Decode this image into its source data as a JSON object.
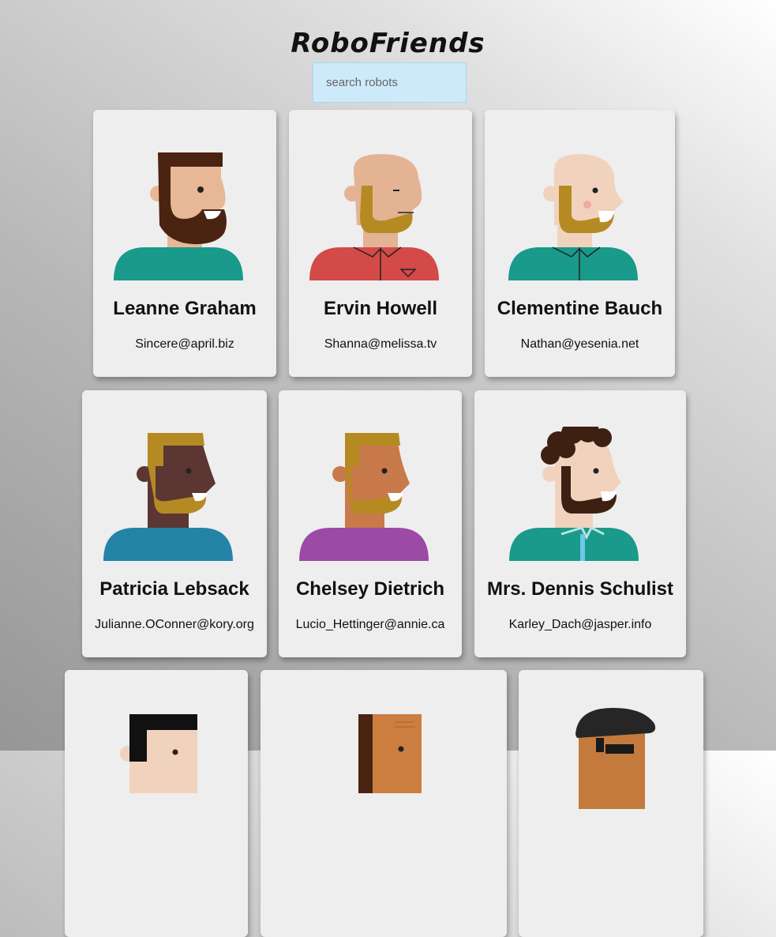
{
  "app": {
    "title": "RoboFriends"
  },
  "search": {
    "placeholder": "search robots",
    "value": ""
  },
  "robots": [
    {
      "name": "Leanne Graham",
      "email": "Sincere@april.biz"
    },
    {
      "name": "Ervin Howell",
      "email": "Shanna@melissa.tv"
    },
    {
      "name": "Clementine Bauch",
      "email": "Nathan@yesenia.net"
    },
    {
      "name": "Patricia Lebsack",
      "email": "Julianne.OConner@kory.org"
    },
    {
      "name": "Chelsey Dietrich",
      "email": "Lucio_Hettinger@annie.ca"
    },
    {
      "name": "Mrs. Dennis Schulist",
      "email": "Karley_Dach@jasper.info"
    },
    {
      "name": "",
      "email": ""
    },
    {
      "name": "",
      "email": ""
    },
    {
      "name": "",
      "email": ""
    }
  ]
}
